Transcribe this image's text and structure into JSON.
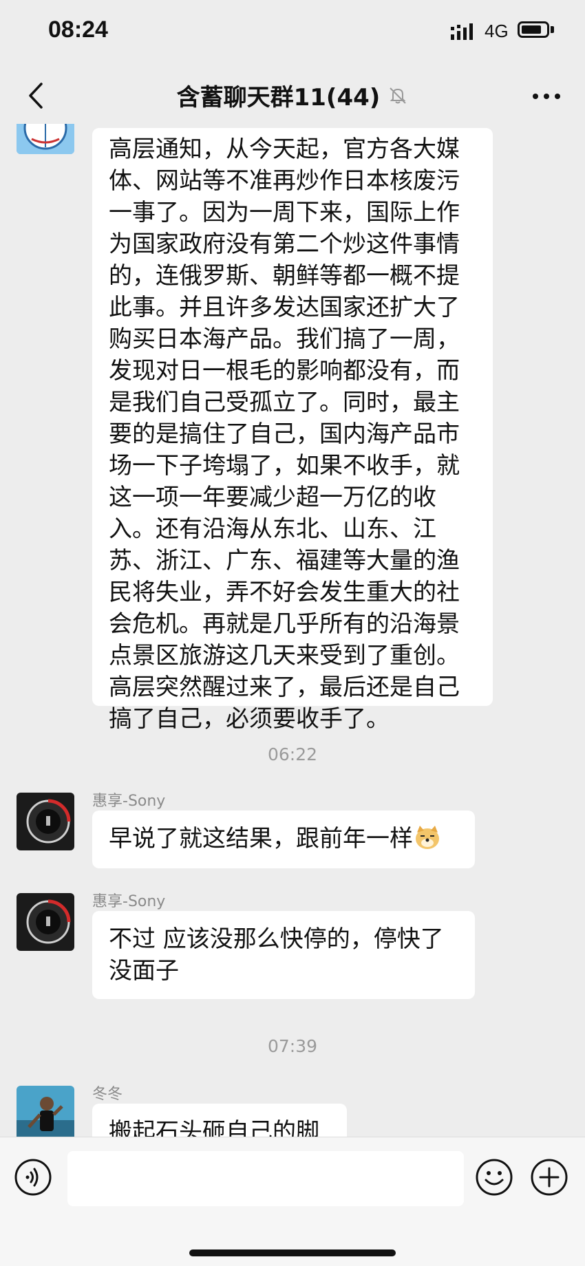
{
  "status": {
    "time": "08:24",
    "network": "4G"
  },
  "header": {
    "title": "含蓄聊天群11(44)"
  },
  "messages": [
    {
      "lines": [
        "高层通知，从今天起，官方各大媒",
        "体、网站等不准再炒作日本核废污",
        "一事了。因为一周下来，国际上作",
        "为国家政府没有第二个炒这件事情",
        "的，连俄罗斯、朝鲜等都一概不提",
        "此事。并且许多发达国家还扩大了",
        "购买日本海产品。我们搞了一周，",
        "发现对日一根毛的影响都没有，而",
        "是我们自己受孤立了。同时，最主",
        "要的是搞住了自己，国内海产品市",
        "场一下子垮塌了，如果不收手，就",
        "这一项一年要减少超一万亿的收",
        "入。还有沿海从东北、山东、江",
        "苏、浙江、广东、福建等大量的渔",
        "民将失业，弄不好会发生重大的社",
        "会危机。再就是几乎所有的沿海景",
        "点景区旅游这几天来受到了重创。",
        "高层突然醒过来了，最后还是自己",
        "搞了自己，必须要收手了。"
      ]
    },
    {
      "timestamp": "06:22"
    },
    {
      "sender": "惠享-Sony",
      "lines": [
        "早说了就这结果，跟前年一样"
      ]
    },
    {
      "sender": "惠享-Sony",
      "lines": [
        "不过 应该没那么快停的，停快了",
        "没面子"
      ]
    },
    {
      "timestamp": "07:39"
    },
    {
      "sender": "冬冬",
      "lines": [
        "搬起石头砸自己的脚"
      ]
    }
  ],
  "input": {
    "placeholder": ""
  },
  "icons": {
    "back": "back-arrow-icon",
    "mute": "muted-bell-icon",
    "more": "more-icon",
    "voice": "voice-icon",
    "emoji": "emoji-icon",
    "plus": "plus-icon"
  }
}
